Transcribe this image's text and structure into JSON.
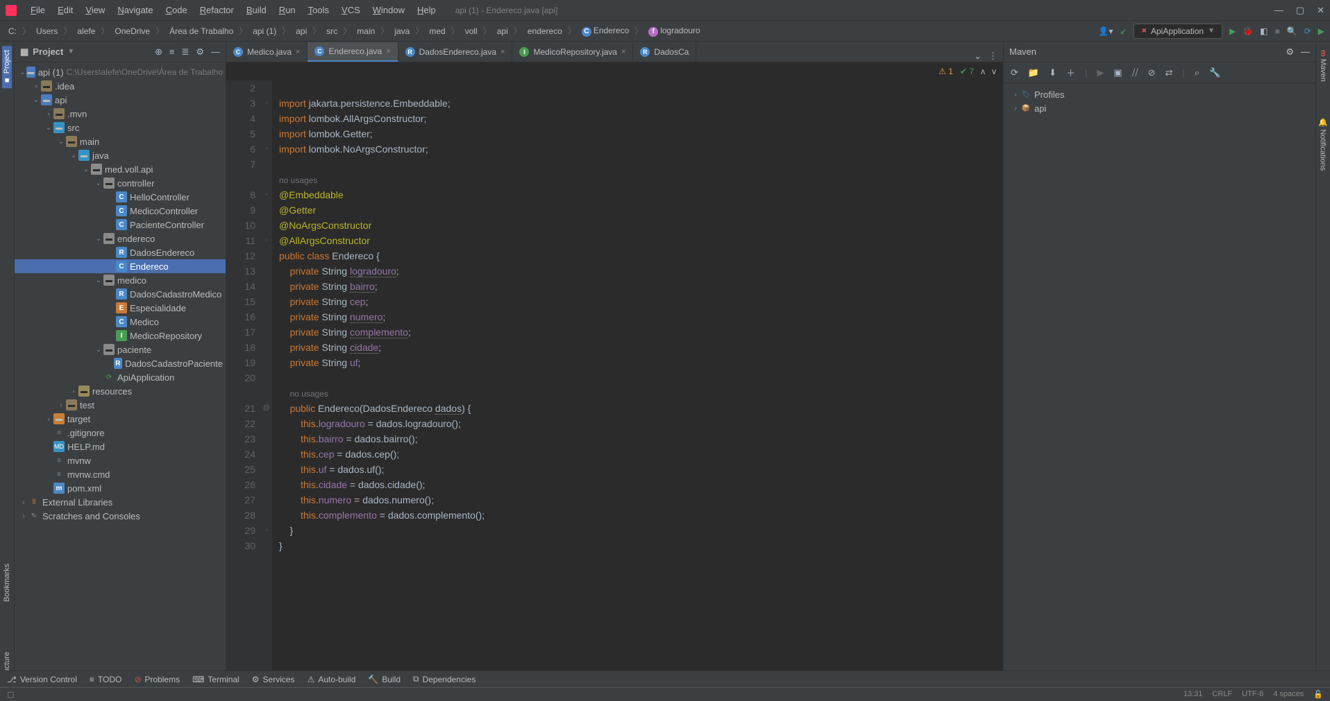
{
  "titlebar": {
    "menus": [
      "File",
      "Edit",
      "View",
      "Navigate",
      "Code",
      "Refactor",
      "Build",
      "Run",
      "Tools",
      "VCS",
      "Window",
      "Help"
    ],
    "title": "api (1) - Endereco.java [api]"
  },
  "breadcrumb": [
    "C:",
    "Users",
    "alefe",
    "OneDrive",
    "Área de Trabalho",
    "api (1)",
    "api",
    "src",
    "main",
    "java",
    "med",
    "voll",
    "api",
    "endereco",
    "Endereco",
    "logradouro"
  ],
  "runconfig": {
    "name": "ApiApplication"
  },
  "project_panel": {
    "title": "Project"
  },
  "tree": {
    "root": {
      "name": "api (1)",
      "path": "C:\\Users\\alefe\\OneDrive\\Área de Trabalho"
    },
    "items": [
      {
        "d": 1,
        "t": "folder",
        "n": ".idea",
        "open": false
      },
      {
        "d": 1,
        "t": "module",
        "n": "api",
        "open": true
      },
      {
        "d": 2,
        "t": "folder",
        "n": ".mvn",
        "open": false
      },
      {
        "d": 2,
        "t": "src-folder",
        "n": "src",
        "open": true
      },
      {
        "d": 3,
        "t": "folder",
        "n": "main",
        "open": true
      },
      {
        "d": 4,
        "t": "src-folder",
        "n": "java",
        "open": true
      },
      {
        "d": 5,
        "t": "package",
        "n": "med.voll.api",
        "open": true
      },
      {
        "d": 6,
        "t": "package",
        "n": "controller",
        "open": true
      },
      {
        "d": 7,
        "t": "class",
        "n": "HelloController"
      },
      {
        "d": 7,
        "t": "class",
        "n": "MedicoController"
      },
      {
        "d": 7,
        "t": "class",
        "n": "PacienteController"
      },
      {
        "d": 6,
        "t": "package",
        "n": "endereco",
        "open": true
      },
      {
        "d": 7,
        "t": "record",
        "n": "DadosEndereco"
      },
      {
        "d": 7,
        "t": "class",
        "n": "Endereco",
        "selected": true
      },
      {
        "d": 6,
        "t": "package",
        "n": "medico",
        "open": true
      },
      {
        "d": 7,
        "t": "record",
        "n": "DadosCadastroMedico"
      },
      {
        "d": 7,
        "t": "enum",
        "n": "Especialidade"
      },
      {
        "d": 7,
        "t": "class",
        "n": "Medico"
      },
      {
        "d": 7,
        "t": "interface",
        "n": "MedicoRepository"
      },
      {
        "d": 6,
        "t": "package",
        "n": "paciente",
        "open": true
      },
      {
        "d": 7,
        "t": "record",
        "n": "DadosCadastroPaciente"
      },
      {
        "d": 6,
        "t": "springapp",
        "n": "ApiApplication"
      },
      {
        "d": 4,
        "t": "res-folder",
        "n": "resources",
        "open": false
      },
      {
        "d": 3,
        "t": "folder",
        "n": "test",
        "open": false
      },
      {
        "d": 2,
        "t": "target",
        "n": "target",
        "open": false
      },
      {
        "d": 2,
        "t": "file",
        "n": ".gitignore"
      },
      {
        "d": 2,
        "t": "md",
        "n": "HELP.md"
      },
      {
        "d": 2,
        "t": "file",
        "n": "mvnw"
      },
      {
        "d": 2,
        "t": "file",
        "n": "mvnw.cmd"
      },
      {
        "d": 2,
        "t": "maven",
        "n": "pom.xml"
      }
    ],
    "ext_libs": "External Libraries",
    "scratches": "Scratches and Consoles"
  },
  "tabs": [
    {
      "name": "Medico.java",
      "icon": "C",
      "color": "#4a88c7"
    },
    {
      "name": "Endereco.java",
      "icon": "C",
      "color": "#4a88c7",
      "active": true
    },
    {
      "name": "DadosEndereco.java",
      "icon": "R",
      "color": "#4a88c7"
    },
    {
      "name": "MedicoRepository.java",
      "icon": "I",
      "color": "#499c54"
    },
    {
      "name": "DadosCa",
      "icon": "R",
      "color": "#4a88c7",
      "truncated": true
    }
  ],
  "inspections": {
    "warn_label": "1",
    "ok_label": "7"
  },
  "code": {
    "lines": [
      {
        "n": 2,
        "raw": ""
      },
      {
        "n": 3,
        "raw": "<span class='kw'>import</span> jakarta.persistence.<span class='cls'>Embeddable</span>;",
        "fold": "-"
      },
      {
        "n": 4,
        "raw": "<span class='kw'>import</span> lombok.<span class='cls'>AllArgsConstructor</span>;"
      },
      {
        "n": 5,
        "raw": "<span class='kw'>import</span> lombok.<span class='cls'>Getter</span>;"
      },
      {
        "n": 6,
        "raw": "<span class='kw'>import</span> lombok.<span class='cls'>NoArgsConstructor</span>;",
        "fold": "-"
      },
      {
        "n": 7,
        "raw": ""
      },
      {
        "n": "",
        "raw": "<span class='hint'>no usages</span>"
      },
      {
        "n": 8,
        "raw": "<span class='ann'>@Embeddable</span>",
        "fold": "-"
      },
      {
        "n": 9,
        "raw": "<span class='ann'>@Getter</span>"
      },
      {
        "n": 10,
        "raw": "<span class='ann'>@NoArgsConstructor</span>"
      },
      {
        "n": 11,
        "raw": "<span class='ann'>@AllArgsConstructor</span>",
        "fold": "-"
      },
      {
        "n": 12,
        "raw": "<span class='kw'>public class</span> <span class='cls'>Endereco</span> {"
      },
      {
        "n": 13,
        "raw": "    <span class='kw'>private</span> String <span class='field underlined'>logradouro</span>;"
      },
      {
        "n": 14,
        "raw": "    <span class='kw'>private</span> String <span class='field underlined'>bairro</span>;"
      },
      {
        "n": 15,
        "raw": "    <span class='kw'>private</span> String <span class='field'>cep</span>;"
      },
      {
        "n": 16,
        "raw": "    <span class='kw'>private</span> String <span class='field underlined'>numero</span>;"
      },
      {
        "n": 17,
        "raw": "    <span class='kw'>private</span> String <span class='field underlined'>complemento</span>;"
      },
      {
        "n": 18,
        "raw": "    <span class='kw'>private</span> String <span class='field underlined'>cidade</span>;"
      },
      {
        "n": 19,
        "raw": "    <span class='kw'>private</span> String <span class='field'>uf</span>;"
      },
      {
        "n": 20,
        "raw": ""
      },
      {
        "n": "",
        "raw": "    <span class='hint'>no usages</span>"
      },
      {
        "n": 21,
        "raw": "    <span class='kw'>public</span> <span class='cls'>Endereco</span>(DadosEndereco <span class='underlined'>dados</span>) {",
        "g": "@",
        "fold": "-"
      },
      {
        "n": 22,
        "raw": "        <span class='kw'>this</span>.<span class='field'>logradouro</span> = dados.logradouro();"
      },
      {
        "n": 23,
        "raw": "        <span class='kw'>this</span>.<span class='field'>bairro</span> = dados.bairro();"
      },
      {
        "n": 24,
        "raw": "        <span class='kw'>this</span>.<span class='field'>cep</span> = dados.cep();"
      },
      {
        "n": 25,
        "raw": "        <span class='kw'>this</span>.<span class='field'>uf</span> = dados.uf();"
      },
      {
        "n": 26,
        "raw": "        <span class='kw'>this</span>.<span class='field'>cidade</span> = dados.cidade();"
      },
      {
        "n": 27,
        "raw": "        <span class='kw'>this</span>.<span class='field'>numero</span> = dados.numero();"
      },
      {
        "n": 28,
        "raw": "        <span class='kw'>this</span>.<span class='field'>complemento</span> = dados.complemento();"
      },
      {
        "n": 29,
        "raw": "    }",
        "fold": "-"
      },
      {
        "n": 30,
        "raw": "}"
      }
    ]
  },
  "maven": {
    "title": "Maven",
    "profiles": "Profiles",
    "root": "api"
  },
  "left_strip": {
    "project": "Project",
    "bookmarks": "Bookmarks",
    "structure": "Structure"
  },
  "right_strip": {
    "maven": "Maven",
    "notifications": "Notifications"
  },
  "statusbar": {
    "items": [
      {
        "label": "Version Control",
        "icon": "branch"
      },
      {
        "label": "TODO",
        "icon": "todo"
      },
      {
        "label": "Problems",
        "icon": "problems",
        "red": true
      },
      {
        "label": "Terminal",
        "icon": "terminal"
      },
      {
        "label": "Services",
        "icon": "services"
      },
      {
        "label": "Auto-build",
        "icon": "warn"
      },
      {
        "label": "Build",
        "icon": "hammer"
      },
      {
        "label": "Dependencies",
        "icon": "deps"
      }
    ]
  },
  "statusbar2": {
    "time": "13:31",
    "lineend": "CRLF",
    "encoding": "UTF-8",
    "indent": "4 spaces"
  }
}
